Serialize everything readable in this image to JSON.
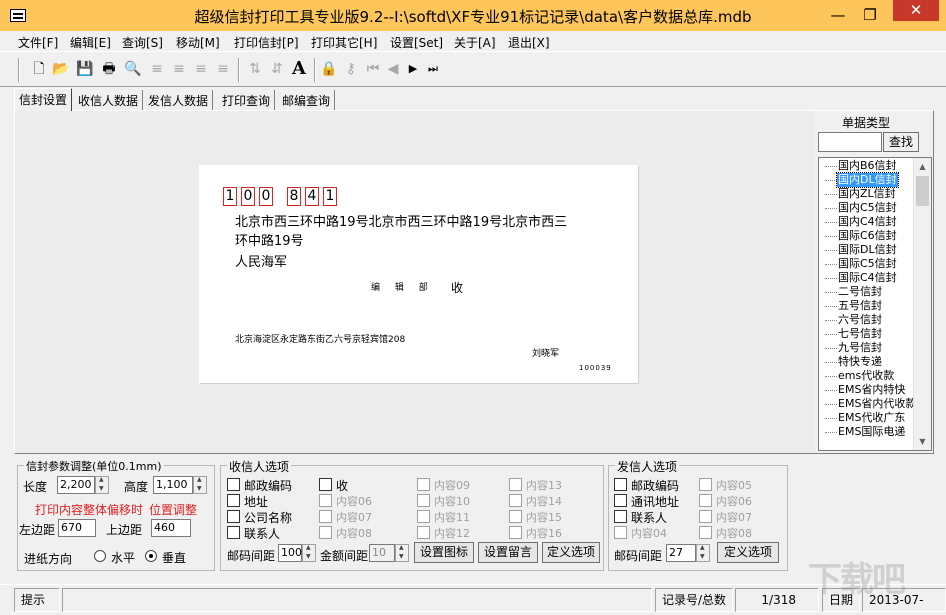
{
  "window": {
    "title": "超级信封打印工具专业版9.2--I:\\softd\\XF专业91标记记录\\data\\客户数据总库.mdb",
    "minimize": "—",
    "restore": "❐",
    "close": "✕"
  },
  "menu": [
    "文件[F]",
    "编辑[E]",
    "查询[S]",
    "移动[M]",
    "打印信封[P]",
    "打印其它[H]",
    "设置[Set]",
    "关于[A]",
    "退出[X]"
  ],
  "tabs": [
    "信封设置",
    "收信人数据",
    "发信人数据",
    "打印查询",
    "邮编查询"
  ],
  "envelope": {
    "postcode_digits": [
      "1",
      "0",
      "0",
      "8",
      "4",
      "1"
    ],
    "recipient_address": "北京市西三环中路19号北京市西三环中路19号北京市西三环中路19号",
    "recipient_name": "人民海军",
    "department": "编 辑 部",
    "receive": "收",
    "sender_address": "北京海淀区永定路东街乙六号京轻宾馆208",
    "sender_name": "刘晓军",
    "sender_postcode": "100039"
  },
  "doc_type": {
    "label": "单据类型",
    "search_button": "查找",
    "items": [
      "国内B6信封",
      "国内DL信封",
      "国内ZL信封",
      "国内C5信封",
      "国内C4信封",
      "国际C6信封",
      "国际DL信封",
      "国际C5信封",
      "国际C4信封",
      "二号信封",
      "五号信封",
      "六号信封",
      "七号信封",
      "九号信封",
      "特快专递",
      "ems代收款",
      "EMS省内特快",
      "EMS省内代收款",
      "EMS代收广东",
      "EMS国际电递"
    ],
    "selected_index": 1
  },
  "params": {
    "title": "信封参数调整(单位0.1mm)",
    "length_label": "长度",
    "length_value": "2,200",
    "height_label": "高度",
    "height_value": "1,100",
    "hint1": "打印内容整体偏移时",
    "hint2": "位置调整",
    "left_margin_label": "左边距",
    "left_margin_value": "670",
    "top_margin_label": "上边距",
    "top_margin_value": "460",
    "feed_label": "进纸方向",
    "horizontal_label": "水平",
    "vertical_label": "垂直",
    "feed_selected": "垂直"
  },
  "recipient_options": {
    "title": "收信人选项",
    "col1": [
      "邮政编码",
      "地址",
      "公司名称",
      "联系人"
    ],
    "col2": [
      "收",
      "内容06",
      "内容07",
      "内容08"
    ],
    "col3": [
      "内容09",
      "内容10",
      "内容11",
      "内容12"
    ],
    "col4": [
      "内容13",
      "内容14",
      "内容15",
      "内容16"
    ],
    "postcode_gap_label": "邮码间距",
    "postcode_gap_value": "100",
    "amount_gap_label": "金额间距",
    "amount_gap_value": "10",
    "btn_icon": "设置图标",
    "btn_note": "设置留言",
    "btn_define": "定义选项"
  },
  "sender_options": {
    "title": "发信人选项",
    "col1": [
      "邮政编码",
      "通讯地址",
      "联系人",
      "内容04"
    ],
    "col2": [
      "内容05",
      "内容06",
      "内容07",
      "内容08"
    ],
    "postcode_gap_label": "邮码间距",
    "postcode_gap_value": "27",
    "btn_define": "定义选项"
  },
  "status": {
    "hint": "提示",
    "record_label": "记录号/总数",
    "record_value": "1/318",
    "date_label": "日期",
    "date_value": "2013-07-"
  },
  "watermark": "下载吧"
}
